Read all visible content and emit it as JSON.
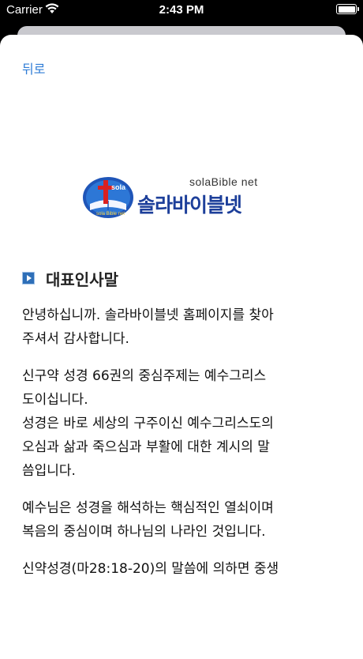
{
  "status_bar": {
    "carrier": "Carrier",
    "time": "2:43 PM",
    "wifi_icon": "wifi-icon",
    "battery_icon": "battery-icon"
  },
  "nav": {
    "back_label": "뒤로"
  },
  "logo": {
    "english_text": "solaBible net",
    "korean_text": "솔라바이블넷",
    "emblem_icon": "cross-book-globe-icon",
    "brand_color": "#1d3f9a"
  },
  "section": {
    "icon": "arrow-bullet-icon",
    "title": "대표인사말"
  },
  "paragraphs": [
    {
      "lines": [
        " 안녕하십니까. 솔라바이블넷 홈페이지를 찾아",
        "주셔서 감사합니다."
      ]
    },
    {
      "lines": [
        " 신구약 성경 66권의 중심주제는 예수그리스",
        "도이십니다.",
        " 성경은 바로 세상의 구주이신 예수그리스도의",
        "오심과 삶과 죽으심과 부활에 대한 계시의 말",
        "씀입니다."
      ]
    },
    {
      "lines": [
        " 예수님은 성경을 해석하는 핵심적인 열쇠이며",
        "복음의 중심이며 하나님의 나라인 것입니다."
      ]
    },
    {
      "lines": [
        " 신약성경(마28:18-20)의 말씀에 의하면 중생"
      ]
    }
  ],
  "colors": {
    "link": "#2f7cd6",
    "text": "#111111",
    "status_bar_bg": "#000000"
  }
}
